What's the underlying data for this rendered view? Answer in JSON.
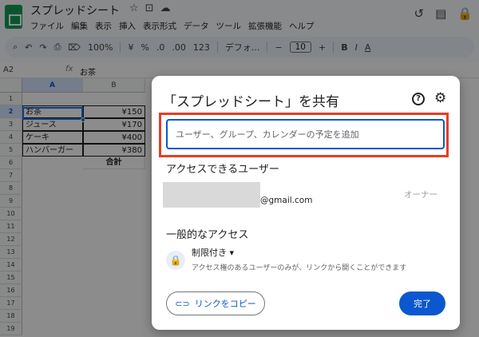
{
  "app": {
    "title": "スプレッドシート",
    "title_icons": [
      "☆",
      "⊡",
      "☁"
    ],
    "menu": [
      "ファイル",
      "編集",
      "表示",
      "挿入",
      "表示形式",
      "データ",
      "ツール",
      "拡張機能",
      "ヘルプ"
    ],
    "right_icons": [
      "↺",
      "▤",
      "🔒"
    ]
  },
  "toolbar": {
    "zoom": "100%",
    "currency": "¥",
    "percent": "%",
    "dec_decrease": ".0",
    "dec_increase": ".00",
    "number_format": "123",
    "font": "デフォ...",
    "font_size": "10",
    "minus": "−",
    "plus": "+",
    "bold": "B",
    "italic": "I",
    "text_color": "A"
  },
  "formula_bar": {
    "cell_ref": "A2",
    "value": "お茶"
  },
  "grid": {
    "columns": [
      "A",
      "B"
    ],
    "rows": [
      "1",
      "2",
      "3",
      "4",
      "5",
      "6",
      "7",
      "8",
      "9",
      "10",
      "11",
      "12",
      "13",
      "14",
      "15",
      "16",
      "17",
      "18",
      "19"
    ],
    "data": [
      {
        "a": "お茶",
        "b": "¥150"
      },
      {
        "a": "ジュース",
        "b": "¥170"
      },
      {
        "a": "ケーキ",
        "b": "¥400"
      },
      {
        "a": "ハンバーガー",
        "b": "¥380"
      }
    ],
    "total_label": "合計"
  },
  "dialog": {
    "title": "「スプレッドシート」を共有",
    "help_icon": "?",
    "settings_icon": "⚙",
    "add_placeholder": "ユーザー、グループ、カレンダーの予定を追加",
    "people_section": "アクセスできるユーザー",
    "email_suffix": "@gmail.com",
    "owner": "オーナー",
    "general_section": "一般的なアクセス",
    "access_level": "制限付き",
    "access_desc": "アクセス権のあるユーザーのみが、リンクから開くことができます",
    "copy_link": "リンクをコピー",
    "done": "完了"
  },
  "colors": {
    "accent": "#0b57d0",
    "highlight": "#e53e24",
    "sheets_green": "#0f9d58"
  }
}
